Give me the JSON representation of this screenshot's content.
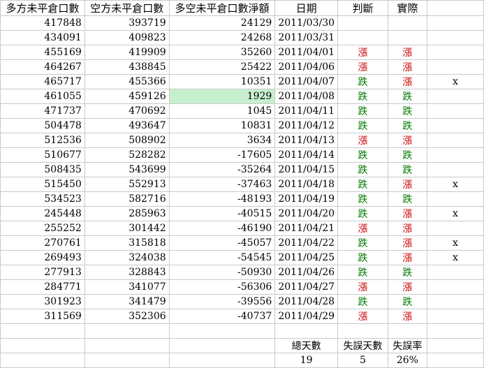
{
  "headers": [
    "多方未平倉口數",
    "空方未平倉口數",
    "多空未平倉口數淨額",
    "日期",
    "判斷",
    "實際",
    ""
  ],
  "rows": [
    {
      "long": "417848",
      "short": "393719",
      "net": "24129",
      "date": "2011/03/30",
      "judge": "",
      "actual": "",
      "mark": "",
      "hl": false
    },
    {
      "long": "434091",
      "short": "409823",
      "net": "24268",
      "date": "2011/03/31",
      "judge": "",
      "actual": "",
      "mark": "",
      "hl": false
    },
    {
      "long": "455169",
      "short": "419909",
      "net": "35260",
      "date": "2011/04/01",
      "judge": "漲",
      "actual": "漲",
      "mark": "",
      "hl": false
    },
    {
      "long": "464267",
      "short": "438845",
      "net": "25422",
      "date": "2011/04/06",
      "judge": "漲",
      "actual": "漲",
      "mark": "",
      "hl": false
    },
    {
      "long": "465717",
      "short": "455366",
      "net": "10351",
      "date": "2011/04/07",
      "judge": "跌",
      "actual": "漲",
      "mark": "x",
      "hl": false
    },
    {
      "long": "461055",
      "short": "459126",
      "net": "1929",
      "date": "2011/04/08",
      "judge": "跌",
      "actual": "跌",
      "mark": "",
      "hl": true
    },
    {
      "long": "471737",
      "short": "470692",
      "net": "1045",
      "date": "2011/04/11",
      "judge": "跌",
      "actual": "跌",
      "mark": "",
      "hl": false
    },
    {
      "long": "504478",
      "short": "493647",
      "net": "10831",
      "date": "2011/04/12",
      "judge": "跌",
      "actual": "跌",
      "mark": "",
      "hl": false
    },
    {
      "long": "512536",
      "short": "508902",
      "net": "3634",
      "date": "2011/04/13",
      "judge": "漲",
      "actual": "漲",
      "mark": "",
      "hl": false
    },
    {
      "long": "510677",
      "short": "528282",
      "net": "-17605",
      "date": "2011/04/14",
      "judge": "跌",
      "actual": "跌",
      "mark": "",
      "hl": false
    },
    {
      "long": "508435",
      "short": "543699",
      "net": "-35264",
      "date": "2011/04/15",
      "judge": "跌",
      "actual": "跌",
      "mark": "",
      "hl": false
    },
    {
      "long": "515450",
      "short": "552913",
      "net": "-37463",
      "date": "2011/04/18",
      "judge": "跌",
      "actual": "漲",
      "mark": "x",
      "hl": false
    },
    {
      "long": "534523",
      "short": "582716",
      "net": "-48193",
      "date": "2011/04/19",
      "judge": "跌",
      "actual": "跌",
      "mark": "",
      "hl": false
    },
    {
      "long": "245448",
      "short": "285963",
      "net": "-40515",
      "date": "2011/04/20",
      "judge": "跌",
      "actual": "漲",
      "mark": "x",
      "hl": false
    },
    {
      "long": "255252",
      "short": "301442",
      "net": "-46190",
      "date": "2011/04/21",
      "judge": "漲",
      "actual": "漲",
      "mark": "",
      "hl": false
    },
    {
      "long": "270761",
      "short": "315818",
      "net": "-45057",
      "date": "2011/04/22",
      "judge": "跌",
      "actual": "漲",
      "mark": "x",
      "hl": false
    },
    {
      "long": "269493",
      "short": "324038",
      "net": "-54545",
      "date": "2011/04/25",
      "judge": "跌",
      "actual": "漲",
      "mark": "x",
      "hl": false
    },
    {
      "long": "277913",
      "short": "328843",
      "net": "-50930",
      "date": "2011/04/26",
      "judge": "跌",
      "actual": "跌",
      "mark": "",
      "hl": false
    },
    {
      "long": "284771",
      "short": "341077",
      "net": "-56306",
      "date": "2011/04/27",
      "judge": "漲",
      "actual": "漲",
      "mark": "",
      "hl": false
    },
    {
      "long": "301923",
      "short": "341479",
      "net": "-39556",
      "date": "2011/04/28",
      "judge": "跌",
      "actual": "跌",
      "mark": "",
      "hl": false
    },
    {
      "long": "311569",
      "short": "352306",
      "net": "-40737",
      "date": "2011/04/29",
      "judge": "漲",
      "actual": "漲",
      "mark": "",
      "hl": false
    }
  ],
  "summary": {
    "total_days_label": "總天數",
    "error_days_label": "失誤天數",
    "error_rate_label": "失誤率",
    "total_days": "19",
    "error_days": "5",
    "error_rate": "26%"
  },
  "colors": {
    "zhang": "#cc0000",
    "die": "#007a00",
    "highlight": "#c6efce",
    "grid": "#c9c9c9"
  }
}
